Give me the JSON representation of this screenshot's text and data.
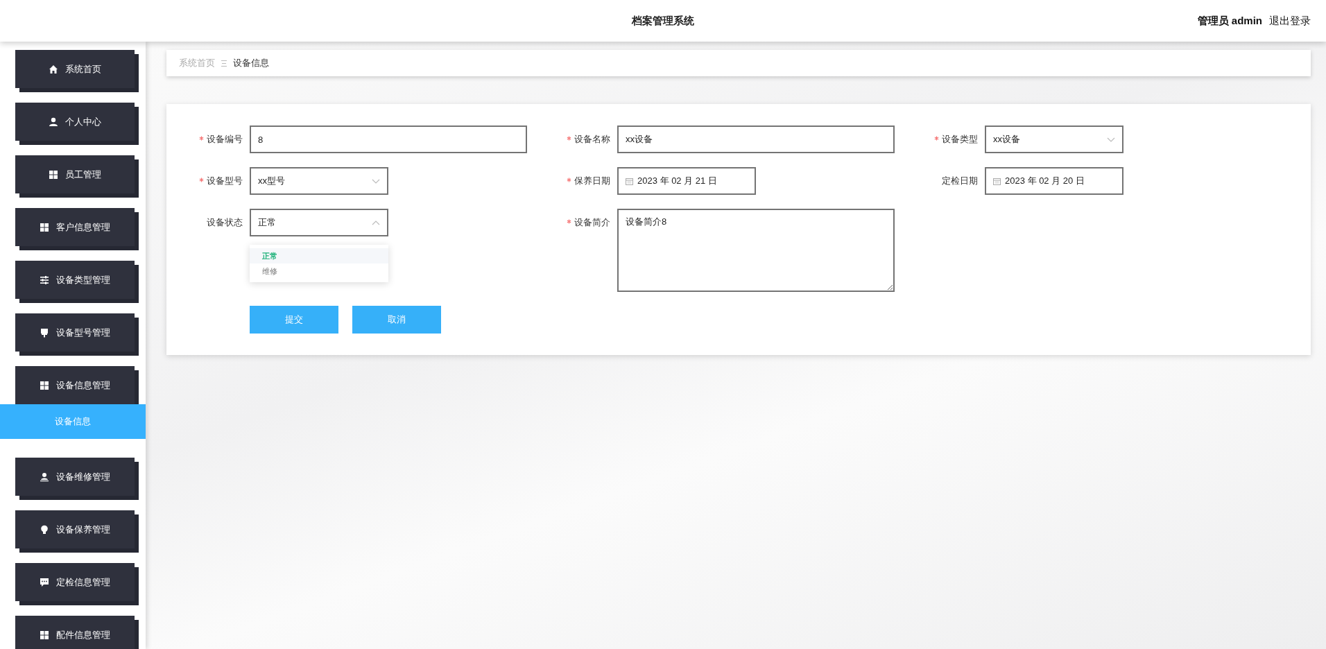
{
  "header": {
    "title": "档案管理系统",
    "user": "管理员 admin",
    "logout": "退出登录"
  },
  "sidebar": {
    "items": [
      {
        "label": "系统首页",
        "selected": false
      },
      {
        "label": "个人中心",
        "selected": false
      },
      {
        "label": "员工管理",
        "selected": false
      },
      {
        "label": "客户信息管理",
        "selected": false
      },
      {
        "label": "设备类型管理",
        "selected": false
      },
      {
        "label": "设备型号管理",
        "selected": false
      },
      {
        "label": "设备信息管理",
        "selected": false,
        "children": [
          {
            "label": "设备信息",
            "selected": true
          }
        ]
      },
      {
        "label": "设备维修管理",
        "selected": false
      },
      {
        "label": "设备保养管理",
        "selected": false
      },
      {
        "label": "定检信息管理",
        "selected": false
      },
      {
        "label": "配件信息管理",
        "selected": false
      }
    ]
  },
  "breadcrumb": [
    "系统首页",
    "设备信息"
  ],
  "form": {
    "fields": [
      {
        "label": "设备编号",
        "required": true,
        "kind": "text",
        "value": "8"
      },
      {
        "label": "设备名称",
        "required": true,
        "kind": "text",
        "value": "xx设备"
      },
      {
        "label": "设备类型",
        "required": true,
        "kind": "select",
        "value": "xx设备",
        "open": false
      },
      {
        "label": "设备型号",
        "required": true,
        "kind": "select",
        "value": "xx型号",
        "open": false
      },
      {
        "label": "保养日期",
        "required": true,
        "kind": "date",
        "value": "2023 年 02 月 21 日"
      },
      {
        "label": "定检日期",
        "required": false,
        "kind": "date",
        "value": "2023 年 02 月 20 日"
      },
      {
        "label": "设备状态",
        "required": false,
        "kind": "select",
        "value": "正常",
        "open": true,
        "options": [
          {
            "label": "正常",
            "selected": true
          },
          {
            "label": "维修",
            "selected": false
          }
        ]
      },
      {
        "label": "设备简介",
        "required": true,
        "kind": "textarea",
        "value": "设备简介8"
      }
    ],
    "buttons": [
      "提交",
      "取消"
    ]
  }
}
